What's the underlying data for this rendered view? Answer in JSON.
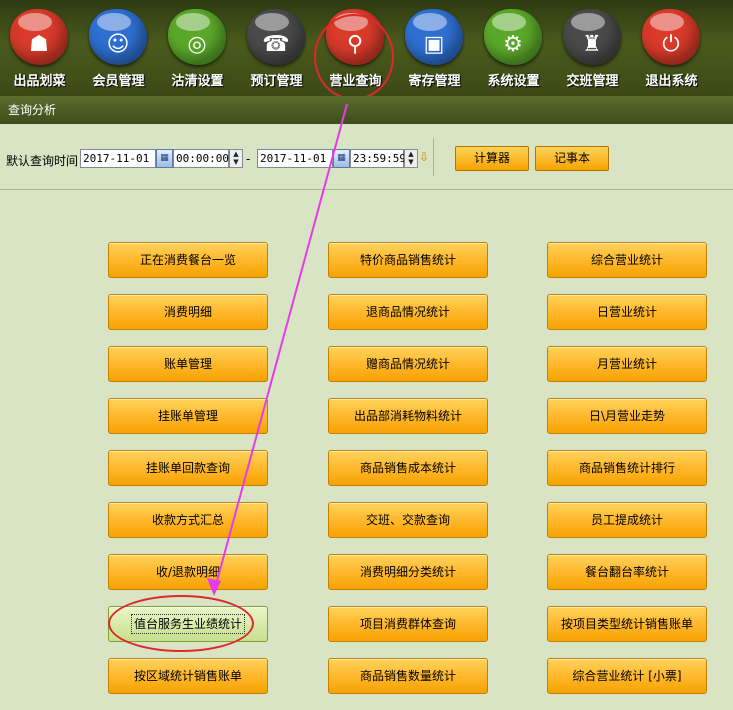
{
  "toolbar": {
    "items": [
      {
        "label": "出品划菜",
        "icon": "food-cover-icon",
        "color": "#d93a2a",
        "glyph": "☗"
      },
      {
        "label": "会员管理",
        "icon": "member-icon",
        "color": "#2e6fd0",
        "glyph": "☺"
      },
      {
        "label": "沽清设置",
        "icon": "plate-icon",
        "color": "#5aa82a",
        "glyph": "◎"
      },
      {
        "label": "预订管理",
        "icon": "phone-icon",
        "color": "#4a4a4a",
        "glyph": "☎"
      },
      {
        "label": "营业查询",
        "icon": "search-icon",
        "color": "#d93a2a",
        "glyph": "⚲"
      },
      {
        "label": "寄存管理",
        "icon": "bag-icon",
        "color": "#2e6fd0",
        "glyph": "▣"
      },
      {
        "label": "系统设置",
        "icon": "gear-icon",
        "color": "#5aa82a",
        "glyph": "⚙"
      },
      {
        "label": "交班管理",
        "icon": "meeting-icon",
        "color": "#4a4a4a",
        "glyph": "♜"
      },
      {
        "label": "退出系统",
        "icon": "power-icon",
        "color": "#d93a2a",
        "glyph": "⏻"
      }
    ]
  },
  "title": "查询分析",
  "query": {
    "label": "默认查询时间",
    "start_date": "2017-11-01",
    "start_time": "00:00:00",
    "separator": "-",
    "end_date": "2017-11-01",
    "end_time": "23:59:59",
    "calculator": "计算器",
    "notepad": "记事本"
  },
  "menu": {
    "col1": [
      "正在消费餐台一览",
      "消费明细",
      "账单管理",
      "挂账单管理",
      "挂账单回款查询",
      "收款方式汇总",
      "收/退款明细",
      "值台服务生业绩统计",
      "按区域统计销售账单"
    ],
    "col2": [
      "特价商品销售统计",
      "退商品情况统计",
      "赠商品情况统计",
      "出品部消耗物料统计",
      "商品销售成本统计",
      "交班、交款查询",
      "消费明细分类统计",
      "项目消费群体查询",
      "商品销售数量统计"
    ],
    "col3": [
      "综合营业统计",
      "日营业统计",
      "月营业统计",
      "日\\月营业走势",
      "商品销售统计排行",
      "员工提成统计",
      "餐台翻台率统计",
      "按项目类型统计销售账单",
      "综合营业统计 [小票]"
    ]
  }
}
